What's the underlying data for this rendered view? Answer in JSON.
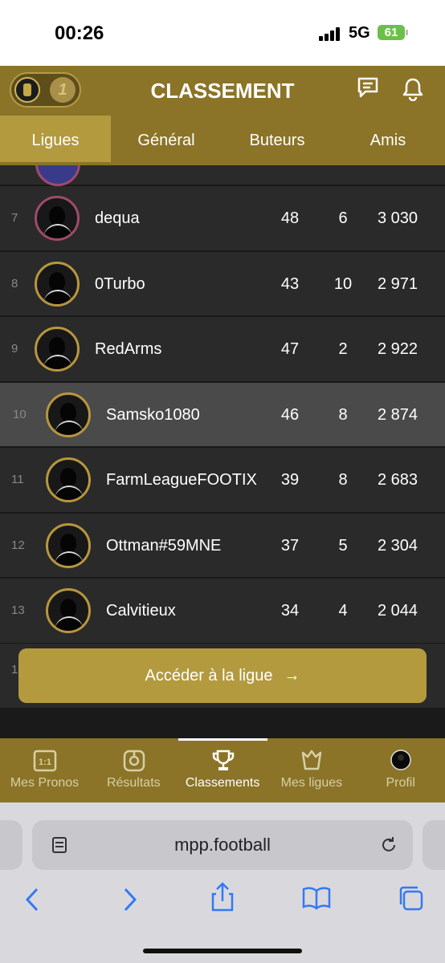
{
  "status_bar": {
    "time": "00:26",
    "network": "5G",
    "battery": "61"
  },
  "header": {
    "title": "CLASSEMENT",
    "logo_number": "1"
  },
  "tabs": [
    {
      "label": "Ligues",
      "active": true
    },
    {
      "label": "Général",
      "active": false
    },
    {
      "label": "Buteurs",
      "active": false
    },
    {
      "label": "Amis",
      "active": false
    }
  ],
  "rows": [
    {
      "rank": "7",
      "name": "dequa",
      "flag": "ba",
      "c1": "48",
      "c2": "6",
      "c3": "3 030",
      "selected": false
    },
    {
      "rank": "8",
      "name": "0Turbo",
      "flag": "it",
      "c1": "43",
      "c2": "10",
      "c3": "2 971",
      "selected": false
    },
    {
      "rank": "9",
      "name": "RedArms",
      "flag": "it",
      "c1": "47",
      "c2": "2",
      "c3": "2 922",
      "selected": false
    },
    {
      "rank": "10",
      "name": "Samsko1080",
      "flag": "it",
      "c1": "46",
      "c2": "8",
      "c3": "2 874",
      "selected": true
    },
    {
      "rank": "11",
      "name": "FarmLeagueFOOTIX",
      "flag": "co",
      "c1": "39",
      "c2": "8",
      "c3": "2 683",
      "selected": false
    },
    {
      "rank": "12",
      "name": "Ottman#59MNE",
      "flag": "es",
      "c1": "37",
      "c2": "5",
      "c3": "2 304",
      "selected": false
    },
    {
      "rank": "13",
      "name": "Calvitieux",
      "flag": "be",
      "c1": "34",
      "c2": "4",
      "c3": "2 044",
      "selected": false
    }
  ],
  "cta": {
    "label": "Accéder à la ligue",
    "arrow": "→"
  },
  "bottom_nav": [
    {
      "label": "Mes Pronos",
      "icon": "match-icon",
      "glyph": "1:1"
    },
    {
      "label": "Résultats",
      "icon": "results-icon",
      "glyph": "◎"
    },
    {
      "label": "Classements",
      "icon": "trophy-icon",
      "glyph": "🏆"
    },
    {
      "label": "Mes ligues",
      "icon": "league-icon",
      "glyph": "✦"
    },
    {
      "label": "Profil",
      "icon": "avatar-icon",
      "glyph": "●"
    }
  ],
  "browser": {
    "url": "mpp.football"
  },
  "colors": {
    "header": "#8b7427",
    "accent": "#b39a3f",
    "row": "#2a2a2a",
    "row_selected": "#4a4a4a"
  }
}
